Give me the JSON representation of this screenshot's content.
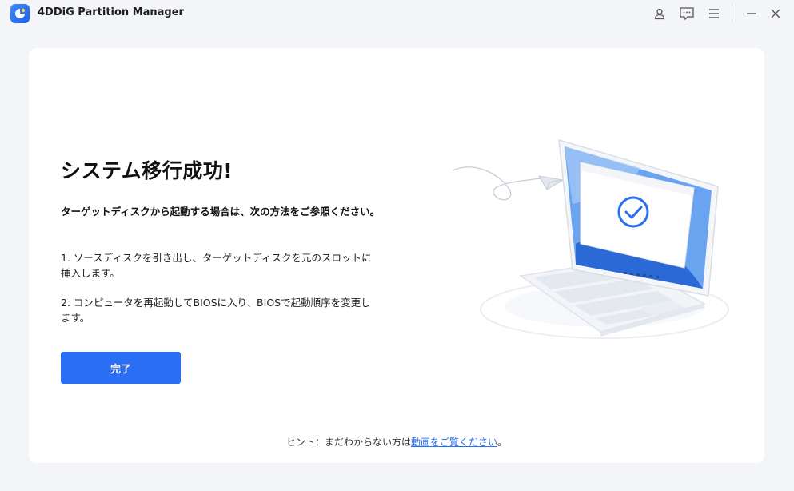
{
  "app": {
    "title": "4DDiG Partition Manager"
  },
  "titlebar": {
    "icons": [
      "user-icon",
      "feedback-icon",
      "menu-icon",
      "minimize-icon",
      "close-icon"
    ]
  },
  "main": {
    "heading": "システム移行成功!",
    "subheading": "ターゲットディスクから起動する場合は、次の方法をご参照ください。",
    "steps": [
      "1. ソースディスクを引き出し、ターゲットディスクを元のスロットに挿入します。",
      "2. コンピュータを再起動してBIOSに入り、BIOSで起動順序を変更します。"
    ],
    "done_button": "完了",
    "hint_prefix": "ヒント：まだわからない方は",
    "hint_link": "動画をご覧ください",
    "hint_suffix": "。"
  },
  "colors": {
    "accent": "#2a6ef6",
    "background": "#f4f5f9",
    "card": "#ffffff"
  }
}
